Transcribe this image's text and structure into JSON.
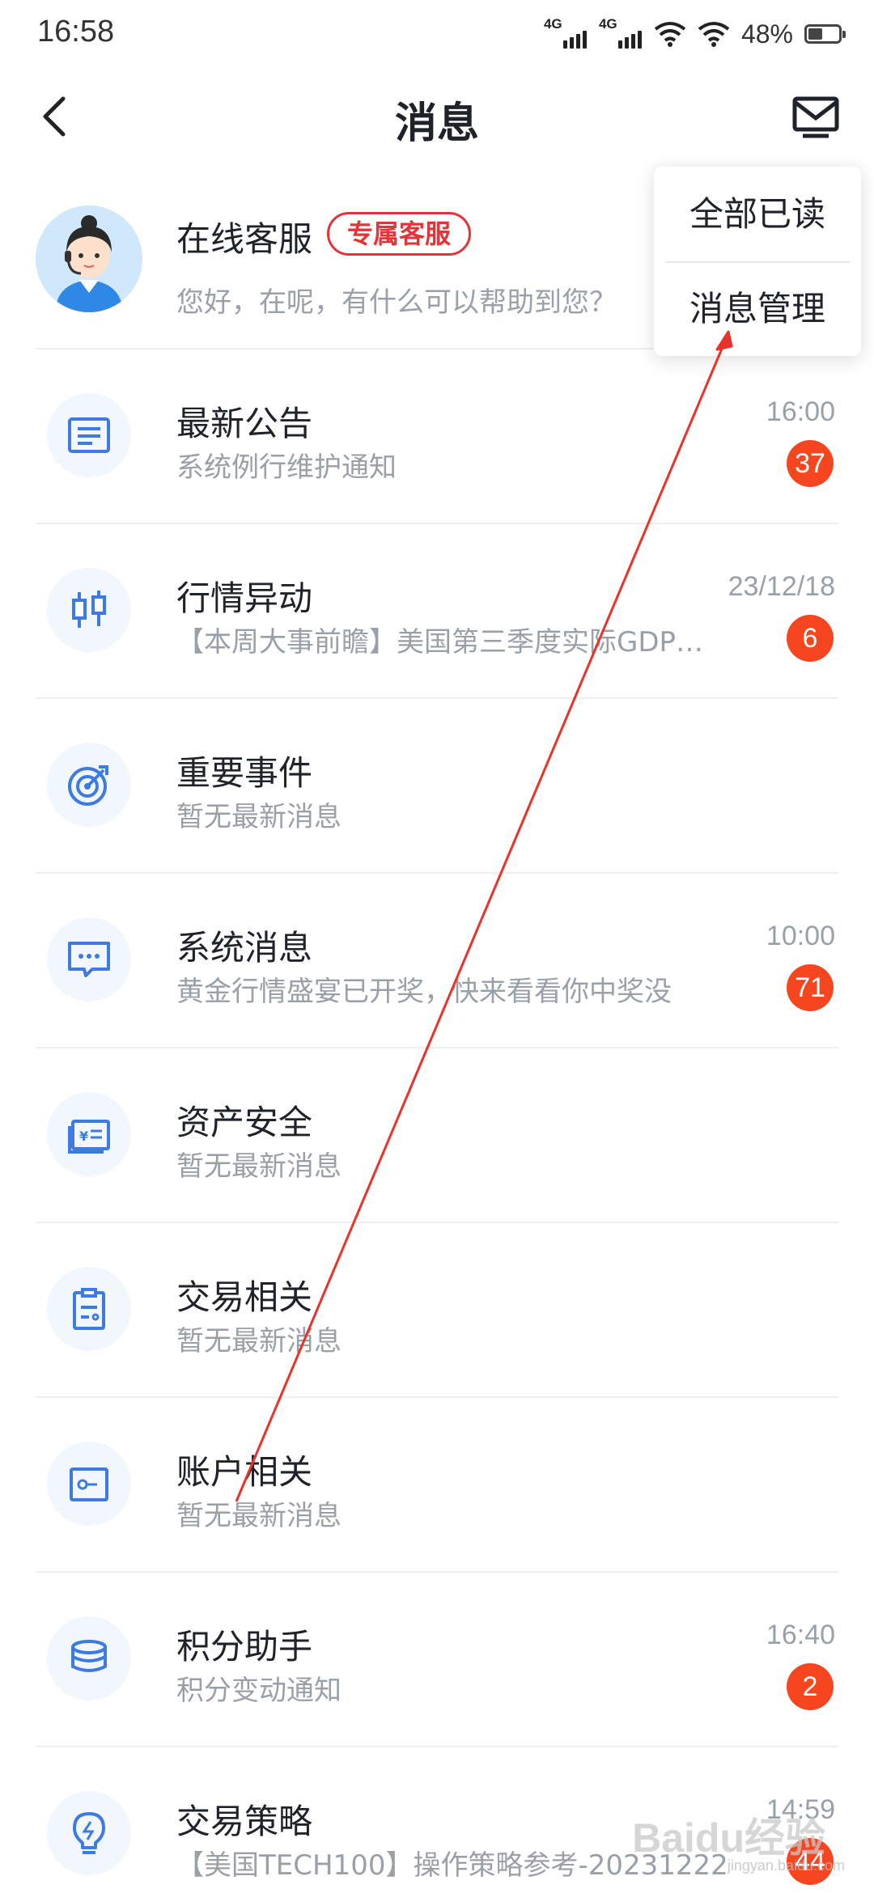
{
  "status_bar": {
    "time": "16:58",
    "network_1": "4G",
    "network_2": "4G",
    "battery_percent": "48%",
    "battery_level": 0.48
  },
  "header": {
    "title": "消息",
    "back_icon": "chevron-left-icon",
    "mail_icon": "mail-icon"
  },
  "dropdown": {
    "items": [
      {
        "label": "全部已读"
      },
      {
        "label": "消息管理"
      }
    ]
  },
  "service": {
    "name": "在线客服",
    "tag": "专属客服",
    "subtitle": "您好，在呢，有什么可以帮助到您？"
  },
  "messages": [
    {
      "title": "最新公告",
      "subtitle": "系统例行维护通知",
      "time": "16:00",
      "badge": "37",
      "icon": "announcement-icon"
    },
    {
      "title": "行情异动",
      "subtitle": "【本周大事前瞻】美国第三季度实际GDP…",
      "time": "23/12/18",
      "badge": "6",
      "icon": "candlestick-icon"
    },
    {
      "title": "重要事件",
      "subtitle": "暂无最新消息",
      "time": "",
      "badge": "",
      "icon": "target-icon"
    },
    {
      "title": "系统消息",
      "subtitle": "黄金行情盛宴已开奖，快来看看你中奖没",
      "time": "10:00",
      "badge": "71",
      "icon": "chat-bubble-icon"
    },
    {
      "title": "资产安全",
      "subtitle": "暂无最新消息",
      "time": "",
      "badge": "",
      "icon": "asset-card-icon"
    },
    {
      "title": "交易相关",
      "subtitle": "暂无最新消息",
      "time": "",
      "badge": "",
      "icon": "clipboard-icon"
    },
    {
      "title": "账户相关",
      "subtitle": "暂无最新消息",
      "time": "",
      "badge": "",
      "icon": "account-key-icon"
    },
    {
      "title": "积分助手",
      "subtitle": "积分变动通知",
      "time": "16:40",
      "badge": "2",
      "icon": "coins-icon"
    },
    {
      "title": "交易策略",
      "subtitle": "【美国TECH100】操作策略参考-20231222",
      "time": "14:59",
      "badge": "44",
      "icon": "lightbulb-icon"
    }
  ],
  "watermark": {
    "brand": "Baidu经验",
    "url": "jingyan.baidu.com"
  },
  "colors": {
    "accent_blue": "#3d7be0",
    "badge_red": "#f5461f",
    "tag_red": "#e3343a",
    "annotation_red": "#e8332a"
  }
}
